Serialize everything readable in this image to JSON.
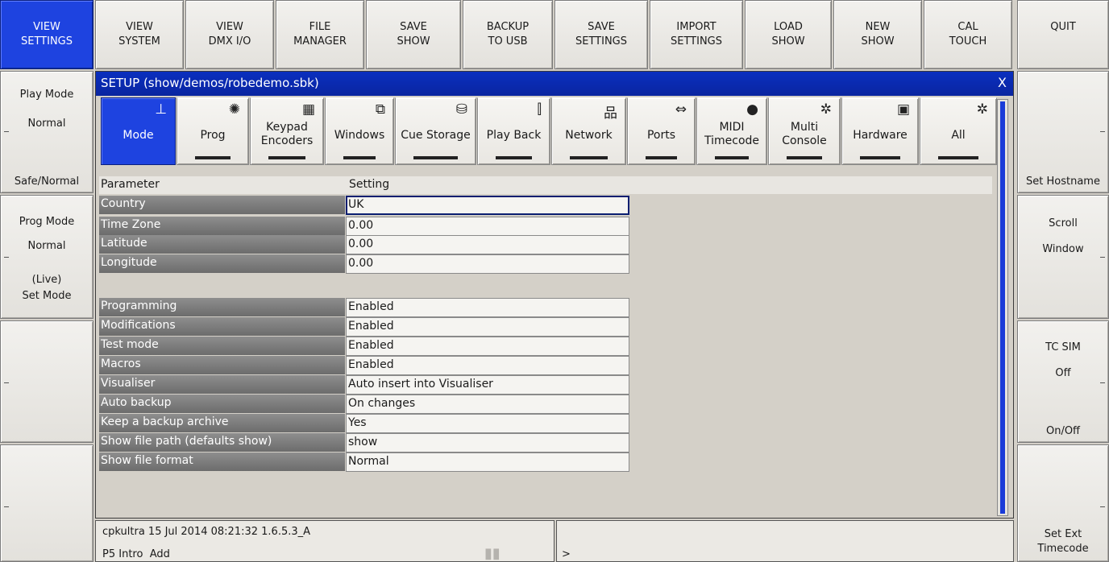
{
  "top_buttons": [
    {
      "line1": "VIEW",
      "line2": "SETTINGS"
    },
    {
      "line1": "VIEW",
      "line2": "SYSTEM"
    },
    {
      "line1": "VIEW",
      "line2": "DMX I/O"
    },
    {
      "line1": "FILE",
      "line2": "MANAGER"
    },
    {
      "line1": "SAVE",
      "line2": "SHOW"
    },
    {
      "line1": "BACKUP",
      "line2": "TO USB"
    },
    {
      "line1": "SAVE",
      "line2": "SETTINGS"
    },
    {
      "line1": "IMPORT",
      "line2": "SETTINGS"
    },
    {
      "line1": "LOAD",
      "line2": "SHOW"
    },
    {
      "line1": "NEW",
      "line2": "SHOW"
    },
    {
      "line1": "CAL",
      "line2": "TOUCH"
    }
  ],
  "quit_label": "QUIT",
  "left_buttons": {
    "play_mode": {
      "title": "Play Mode",
      "value": "Normal",
      "action": "Safe/Normal"
    },
    "prog_mode": {
      "title": "Prog Mode",
      "value": "Normal",
      "sub": "(Live)",
      "action": "Set Mode"
    }
  },
  "right_buttons": {
    "hostname": {
      "action": "Set Hostname"
    },
    "scroll": {
      "line1": "Scroll",
      "line2": "Window"
    },
    "tc_sim": {
      "title": "TC SIM",
      "value": "Off",
      "action": "On/Off"
    },
    "ext_tc": {
      "line1": "Set Ext",
      "line2": "Timecode"
    }
  },
  "window": {
    "title": "SETUP (show/demos/robedemo.sbk)",
    "close": "X"
  },
  "tabs": [
    {
      "label": "Mode",
      "icon": "⊥"
    },
    {
      "label": "Prog",
      "icon": "✺"
    },
    {
      "label": "Keypad\nEncoders",
      "icon": "▦"
    },
    {
      "label": "Windows",
      "icon": "⧉"
    },
    {
      "label": "Cue Storage",
      "icon": "⛁"
    },
    {
      "label": "Play Back",
      "icon": "⫿"
    },
    {
      "label": "Network",
      "icon": "品"
    },
    {
      "label": "Ports",
      "icon": "⇔"
    },
    {
      "label": "MIDI\nTimecode",
      "icon": "●"
    },
    {
      "label": "Multi\nConsole",
      "icon": "✲"
    },
    {
      "label": "Hardware",
      "icon": "▣"
    },
    {
      "label": "All",
      "icon": "✲"
    }
  ],
  "table": {
    "col_param": "Parameter",
    "col_setting": "Setting",
    "rows": [
      {
        "param": "Country",
        "value": "UK"
      },
      {
        "param": "Time Zone",
        "value": "0.00"
      },
      {
        "param": "Latitude",
        "value": "0.00"
      },
      {
        "param": "Longitude",
        "value": "0.00"
      },
      {
        "param": "Programming",
        "value": "Enabled"
      },
      {
        "param": "Modifications",
        "value": "Enabled"
      },
      {
        "param": "Test mode",
        "value": "Enabled"
      },
      {
        "param": "Macros",
        "value": "Enabled"
      },
      {
        "param": "Visualiser",
        "value": "Auto insert into Visualiser"
      },
      {
        "param": "Auto backup",
        "value": "On changes"
      },
      {
        "param": "Keep a backup archive",
        "value": "Yes"
      },
      {
        "param": "Show file path (defaults show)",
        "value": "show"
      },
      {
        "param": "Show file format",
        "value": "Normal"
      }
    ]
  },
  "status": {
    "line1": "cpkultra 15 Jul 2014 08:21:32 1.6.5.3_A",
    "line2": "P5 Intro  Add",
    "pause_icon": "▮▮",
    "prompt": ">"
  },
  "colors": {
    "accent": "#1e43e0",
    "param_cell": "#7a7a7a",
    "background": "#d4d0c8"
  }
}
